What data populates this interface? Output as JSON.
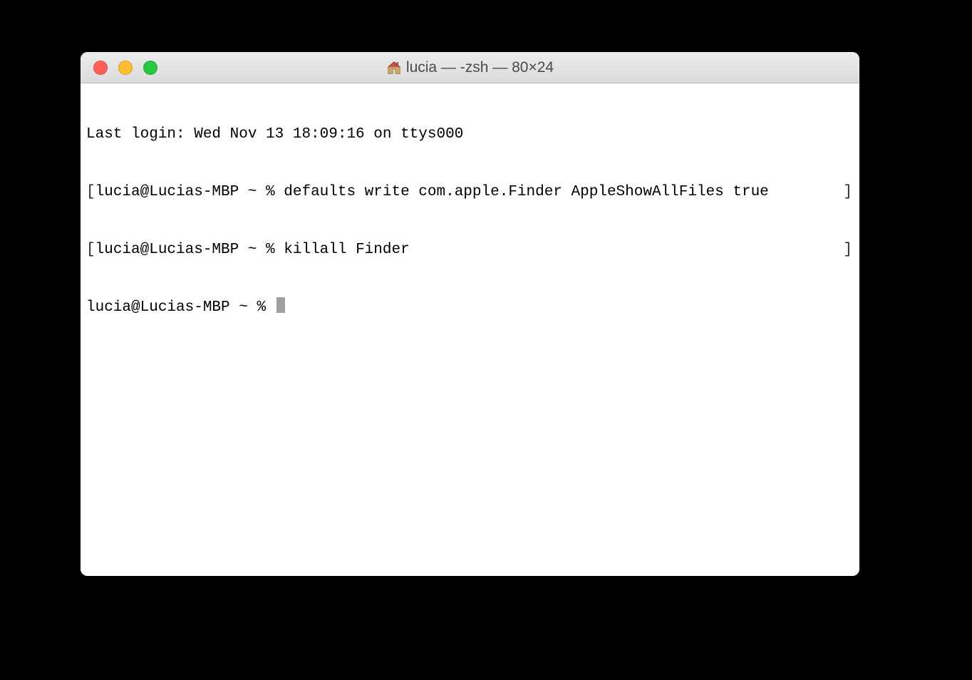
{
  "window": {
    "title": "lucia — -zsh — 80×24"
  },
  "terminal": {
    "last_login": "Last login: Wed Nov 13 18:09:16 on ttys000",
    "lines": [
      {
        "prompt": "lucia@Lucias-MBP ~ % ",
        "command": "defaults write com.apple.Finder AppleShowAllFiles true",
        "bracketed": true
      },
      {
        "prompt": "lucia@Lucias-MBP ~ % ",
        "command": "killall Finder",
        "bracketed": true
      },
      {
        "prompt": "lucia@Lucias-MBP ~ % ",
        "command": "",
        "bracketed": false,
        "cursor": true
      }
    ]
  }
}
